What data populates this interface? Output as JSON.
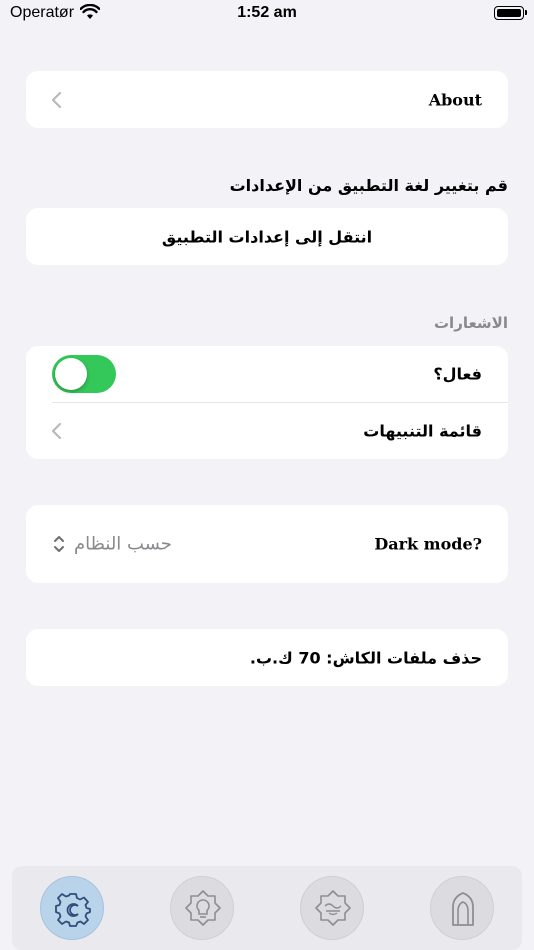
{
  "status_bar": {
    "carrier": "Operatør",
    "time": "1:52 am"
  },
  "about": {
    "label": "About"
  },
  "language": {
    "heading": "قم بتغيير لغة التطبيق من الإعدادات",
    "button_label": "انتقل إلى إعدادات التطبيق"
  },
  "notifications": {
    "section_title": "الاشعارات",
    "enabled_label": "فعال؟",
    "enabled": true,
    "alerts_list_label": "قائمة التنبيهات"
  },
  "dark_mode": {
    "label": "Dark mode?",
    "value": "حسب النظام"
  },
  "cache": {
    "label": "حذف ملفات الكاش: 70 ك.ب."
  },
  "tab_bar": {
    "tabs": [
      {
        "icon": "gear-icon",
        "active": true
      },
      {
        "icon": "lightbulb-icon",
        "active": false
      },
      {
        "icon": "subhanallah-icon",
        "active": false
      },
      {
        "icon": "mosque-door-icon",
        "active": false
      }
    ]
  },
  "colors": {
    "toggle_on": "#34c759",
    "active_tab": "#b9d3ea",
    "background": "#f2f2f7"
  }
}
